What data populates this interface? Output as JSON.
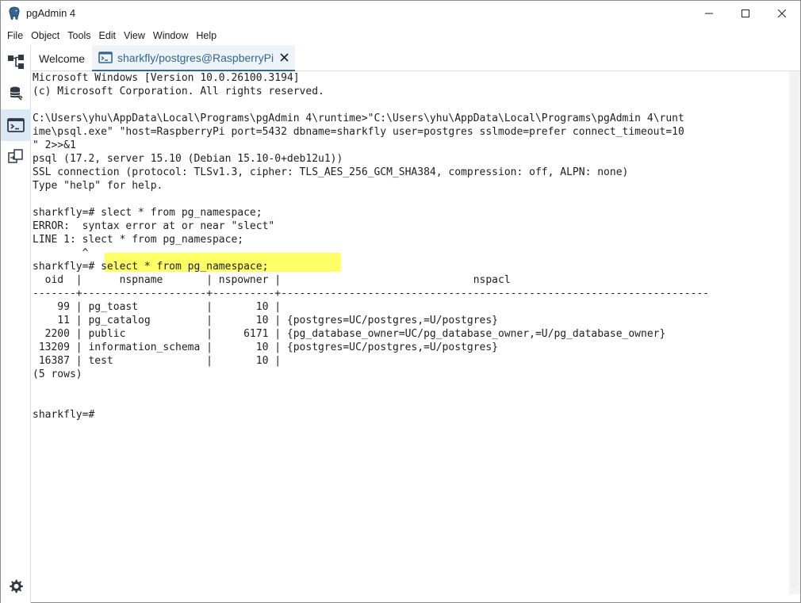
{
  "window": {
    "title": "pgAdmin 4"
  },
  "menu": {
    "items": [
      "File",
      "Object",
      "Tools",
      "Edit",
      "View",
      "Window",
      "Help"
    ]
  },
  "tabs": {
    "welcome": "Welcome",
    "psql": "sharkfly/postgres@RaspberryPi"
  },
  "rail": {
    "icons": [
      "object-explorer-icon",
      "database-icon",
      "psql-tool-icon",
      "schema-diff-icon",
      "settings-gear-icon"
    ]
  },
  "terminal": {
    "lines": [
      "Microsoft Windows [Version 10.0.26100.3194]",
      "(c) Microsoft Corporation. All rights reserved.",
      "",
      "C:\\Users\\yhu\\AppData\\Local\\Programs\\pgAdmin 4\\runtime>\"C:\\Users\\yhu\\AppData\\Local\\Programs\\pgAdmin 4\\runt",
      "ime\\psql.exe\" \"host=RaspberryPi port=5432 dbname=sharkfly user=postgres sslmode=prefer connect_timeout=10",
      "\" 2>>&1",
      "psql (17.2, server 15.10 (Debian 15.10-0+deb12u1))",
      "SSL connection (protocol: TLSv1.3, cipher: TLS_AES_256_GCM_SHA384, compression: off, ALPN: none)",
      "Type \"help\" for help.",
      "",
      "sharkfly=# slect * from pg_namespace;",
      "ERROR:  syntax error at or near \"slect\"",
      "LINE 1: slect * from pg_namespace;",
      "        ^",
      "sharkfly=# select * from pg_namespace;",
      "  oid  |      nspname       | nspowner |                               nspacl",
      "-------+--------------------+----------+---------------------------------------------------------------------",
      "    99 | pg_toast           |       10 |",
      "    11 | pg_catalog         |       10 | {postgres=UC/postgres,=U/postgres}",
      "  2200 | public             |     6171 | {pg_database_owner=UC/pg_database_owner,=U/pg_database_owner}",
      " 13209 | information_schema |       10 | {postgres=UC/postgres,=U/postgres}",
      " 16387 | test               |       10 |",
      "(5 rows)",
      "",
      "",
      "sharkfly=#"
    ]
  }
}
